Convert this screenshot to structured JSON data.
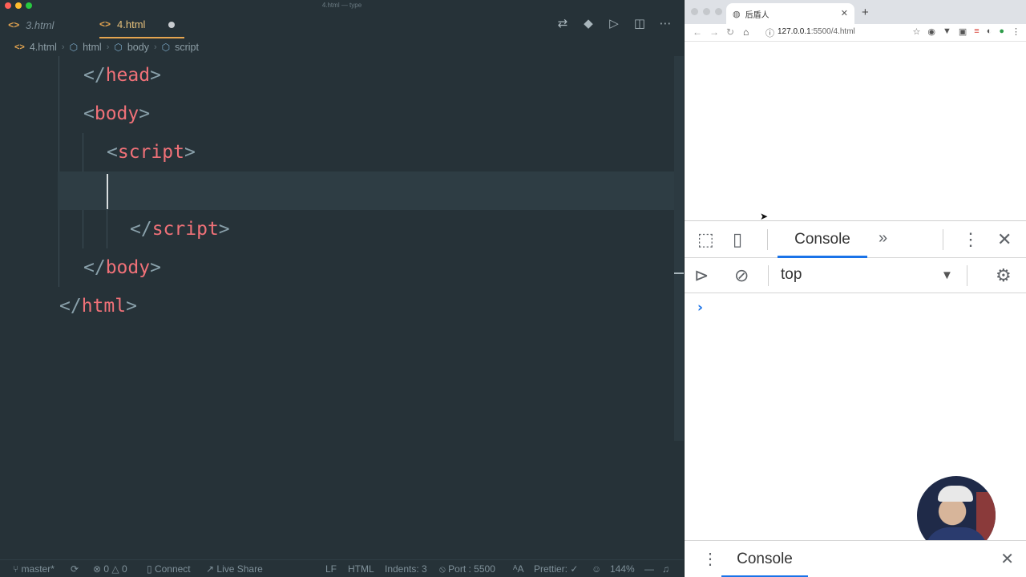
{
  "window": {
    "title": "4.html — type",
    "dot_colors": [
      "#ff5f57",
      "#febc2e",
      "#28c840"
    ]
  },
  "editor": {
    "tabs": [
      {
        "label": "3.html",
        "active": false
      },
      {
        "label": "4.html",
        "active": true,
        "dirty": true
      }
    ],
    "tab_icon": "<>",
    "breadcrumb": [
      "4.html",
      "html",
      "body",
      "script"
    ],
    "actions": [
      "compare-icon",
      "git-icon",
      "run-icon",
      "split-icon",
      "more-icon"
    ],
    "code": {
      "head_close": "head",
      "body_open": "body",
      "script_open": "script",
      "script_close": "script",
      "body_close": "body",
      "html_close": "html"
    }
  },
  "statusbar": {
    "branch": "master*",
    "problems_errors": "0",
    "problems_warnings": "0",
    "connect": "Connect",
    "live_share": "Live Share",
    "eol": "LF",
    "language": "HTML",
    "indents": "Indents: 3",
    "port": "Port : 5500",
    "prettier": "Prettier: ✓",
    "zoom": "144%"
  },
  "browser": {
    "tab_title": "后盾人",
    "url_host": "127.0.0.1",
    "url_rest": ":5500/4.html",
    "devtools": {
      "main_tab": "Console",
      "context": "top",
      "drawer_tab": "Console",
      "accent_color": "#1a73e8"
    }
  }
}
